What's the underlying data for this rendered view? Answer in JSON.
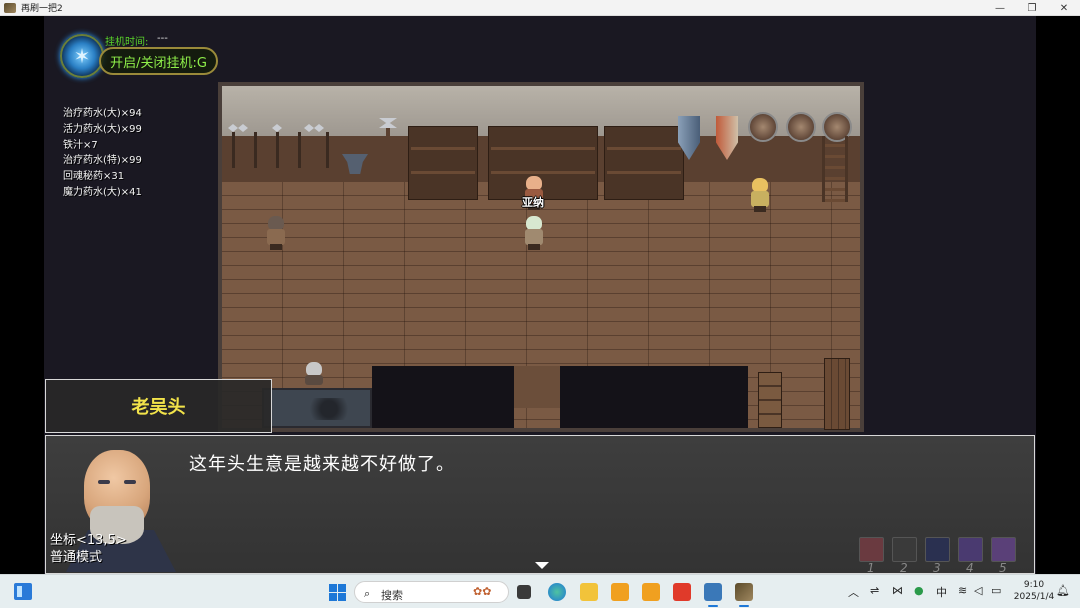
{
  "window": {
    "title": "再刷一把2",
    "minimize_glyph": "—",
    "maximize_glyph": "❐",
    "close_glyph": "✕"
  },
  "hud": {
    "afk_time_label": "挂机时间:",
    "afk_time_value": "---",
    "afk_toggle_label": "开启/关闭挂机:G",
    "accent_color": "#59d32a"
  },
  "inventory": [
    "治疗药水(大)×94",
    "活力药水(大)×99",
    "铁汁×7",
    "治疗药水(特)×99",
    "回魂秘药×31",
    "魔力药水(大)×41"
  ],
  "npc_label": "亚纳",
  "dialog": {
    "speaker": "老吴头",
    "text": "这年头生意是越来越不好做了。",
    "coords": "坐标<13,5>",
    "mode": "普通模式",
    "speaker_color": "#f2e34a"
  },
  "skill_slots": [
    "1",
    "2",
    "3",
    "4",
    "5"
  ],
  "taskbar": {
    "search_icon": "search-icon",
    "search_placeholder": "搜索",
    "ime": "中",
    "time": "9:10",
    "date": "2025/1/4"
  }
}
